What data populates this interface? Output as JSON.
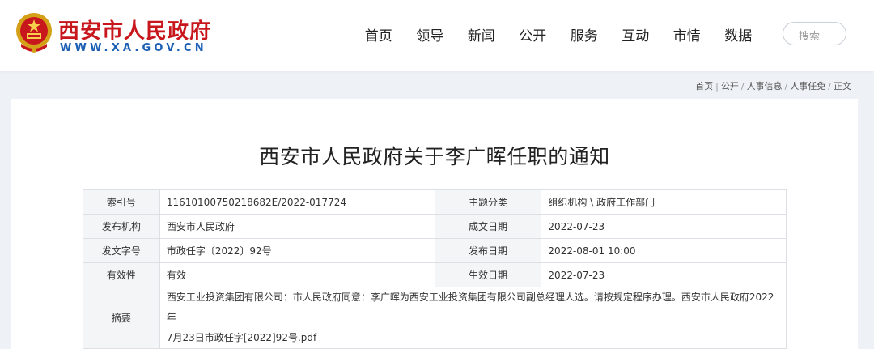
{
  "header": {
    "site_name": "西安市人民政府",
    "site_url": "WWW.XA.GOV.CN",
    "nav": [
      "首页",
      "领导",
      "新闻",
      "公开",
      "服务",
      "互动",
      "市情",
      "数据"
    ],
    "search_placeholder": "搜索"
  },
  "breadcrumb": [
    "首页",
    "公开",
    "人事信息",
    "人事任免",
    "正文"
  ],
  "article": {
    "title": "西安市人民政府关于李广晖任职的通知"
  },
  "meta": {
    "index_label": "索引号",
    "index_value": "11610100750218682E/2022-017724",
    "topic_label": "主题分类",
    "topic_value": "组织机构 \\ 政府工作部门",
    "publisher_label": "发布机构",
    "publisher_value": "西安市人民政府",
    "written_date_label": "成文日期",
    "written_date_value": "2022-07-23",
    "doc_number_label": "发文字号",
    "doc_number_value": "市政任字〔2022〕92号",
    "publish_date_label": "发布日期",
    "publish_date_value": "2022-08-01 10:00",
    "validity_label": "有效性",
    "validity_value": "有效",
    "effective_date_label": "生效日期",
    "effective_date_value": "2022-07-23",
    "abstract_label": "摘要",
    "abstract_line1": "西安工业投资集团有限公司：市人民政府同意：李广晖为西安工业投资集团有限公司副总经理人选。请按规定程序办理。西安市人民政府2022年",
    "abstract_line2": "7月23日市政任字[2022]92号.pdf"
  },
  "colors": {
    "brand_red": "#c8161d",
    "url_blue": "#1a5fb4",
    "page_bg": "#eef2f7"
  }
}
